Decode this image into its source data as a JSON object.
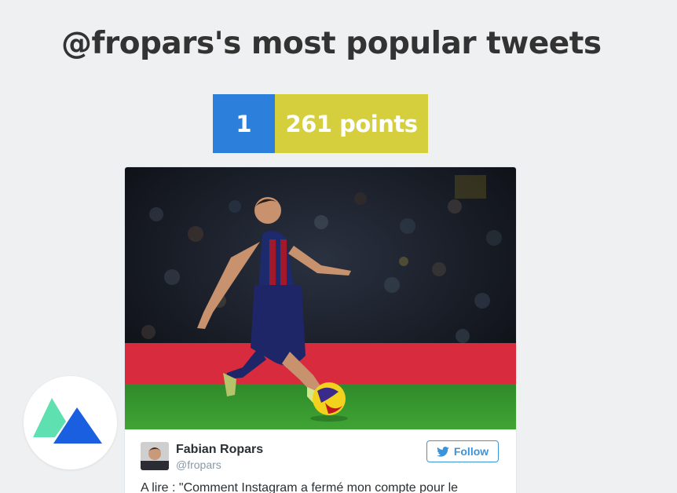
{
  "page": {
    "title": "@fropars's most popular tweets"
  },
  "ranking": {
    "rank": "1",
    "points": "261 points",
    "rank_color": "#2c7fdb",
    "points_color": "#d5cf3d"
  },
  "tweet": {
    "photo_icon": "soccer-player-photo",
    "author_name": "Fabian Ropars",
    "author_handle": "@fropars",
    "follow_label": "Follow",
    "follow_icon": "twitter-bird-icon",
    "text": "A lire : \"Comment Instagram a fermé mon compte pour le",
    "accent_color": "#3b94d9"
  },
  "brand": {
    "logo_icon": "mountain-logo-icon",
    "logo_colors": [
      "#5ee0b0",
      "#1a5fe0"
    ]
  }
}
